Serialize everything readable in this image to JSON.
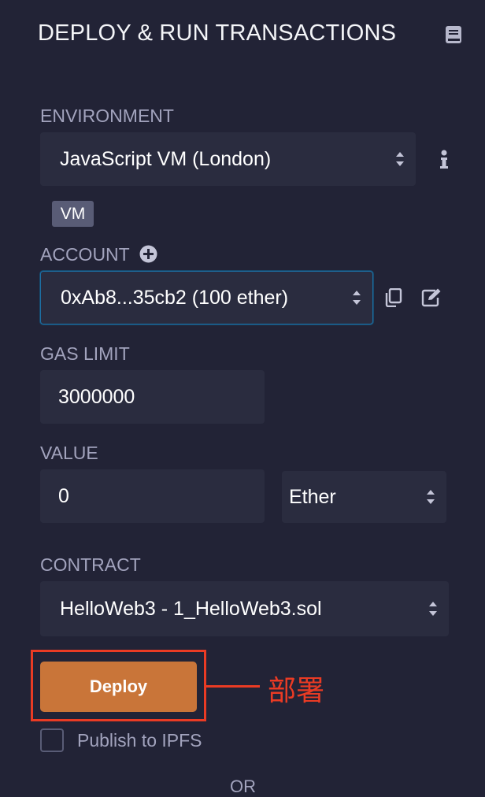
{
  "header": {
    "title": "DEPLOY & RUN TRANSACTIONS",
    "icon": "book-icon"
  },
  "environment": {
    "label": "ENVIRONMENT",
    "selected": "JavaScript VM (London)",
    "badge": "VM"
  },
  "account": {
    "label": "ACCOUNT",
    "selected": "0xAb8...35cb2 (100 ether)"
  },
  "gas_limit": {
    "label": "GAS LIMIT",
    "value": "3000000"
  },
  "value": {
    "label": "VALUE",
    "amount": "0",
    "unit": "Ether"
  },
  "contract": {
    "label": "CONTRACT",
    "selected": "HelloWeb3 - 1_HelloWeb3.sol"
  },
  "deploy": {
    "label": "Deploy"
  },
  "annotation": {
    "text": "部署",
    "color": "#ea3b24"
  },
  "publish": {
    "label": "Publish to IPFS",
    "checked": false
  },
  "or_label": "OR",
  "colors": {
    "background": "#222336",
    "control": "#2a2c3f",
    "deploy": "#c97539",
    "accent_border": "#1d6fa3"
  }
}
